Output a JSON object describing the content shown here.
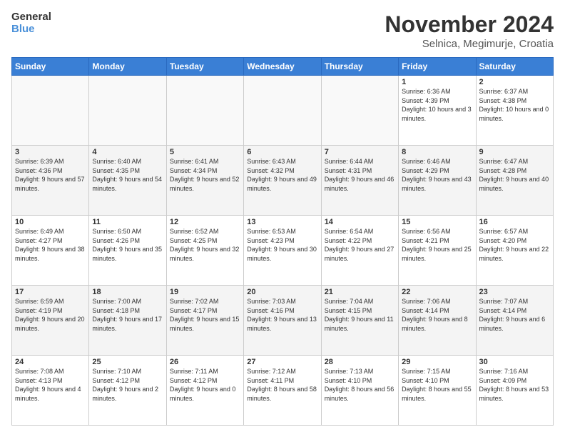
{
  "header": {
    "logo_general": "General",
    "logo_blue": "Blue",
    "month_title": "November 2024",
    "location": "Selnica, Megimurje, Croatia"
  },
  "days_of_week": [
    "Sunday",
    "Monday",
    "Tuesday",
    "Wednesday",
    "Thursday",
    "Friday",
    "Saturday"
  ],
  "weeks": [
    [
      {
        "day": "",
        "info": ""
      },
      {
        "day": "",
        "info": ""
      },
      {
        "day": "",
        "info": ""
      },
      {
        "day": "",
        "info": ""
      },
      {
        "day": "",
        "info": ""
      },
      {
        "day": "1",
        "info": "Sunrise: 6:36 AM\nSunset: 4:39 PM\nDaylight: 10 hours and 3 minutes."
      },
      {
        "day": "2",
        "info": "Sunrise: 6:37 AM\nSunset: 4:38 PM\nDaylight: 10 hours and 0 minutes."
      }
    ],
    [
      {
        "day": "3",
        "info": "Sunrise: 6:39 AM\nSunset: 4:36 PM\nDaylight: 9 hours and 57 minutes."
      },
      {
        "day": "4",
        "info": "Sunrise: 6:40 AM\nSunset: 4:35 PM\nDaylight: 9 hours and 54 minutes."
      },
      {
        "day": "5",
        "info": "Sunrise: 6:41 AM\nSunset: 4:34 PM\nDaylight: 9 hours and 52 minutes."
      },
      {
        "day": "6",
        "info": "Sunrise: 6:43 AM\nSunset: 4:32 PM\nDaylight: 9 hours and 49 minutes."
      },
      {
        "day": "7",
        "info": "Sunrise: 6:44 AM\nSunset: 4:31 PM\nDaylight: 9 hours and 46 minutes."
      },
      {
        "day": "8",
        "info": "Sunrise: 6:46 AM\nSunset: 4:29 PM\nDaylight: 9 hours and 43 minutes."
      },
      {
        "day": "9",
        "info": "Sunrise: 6:47 AM\nSunset: 4:28 PM\nDaylight: 9 hours and 40 minutes."
      }
    ],
    [
      {
        "day": "10",
        "info": "Sunrise: 6:49 AM\nSunset: 4:27 PM\nDaylight: 9 hours and 38 minutes."
      },
      {
        "day": "11",
        "info": "Sunrise: 6:50 AM\nSunset: 4:26 PM\nDaylight: 9 hours and 35 minutes."
      },
      {
        "day": "12",
        "info": "Sunrise: 6:52 AM\nSunset: 4:25 PM\nDaylight: 9 hours and 32 minutes."
      },
      {
        "day": "13",
        "info": "Sunrise: 6:53 AM\nSunset: 4:23 PM\nDaylight: 9 hours and 30 minutes."
      },
      {
        "day": "14",
        "info": "Sunrise: 6:54 AM\nSunset: 4:22 PM\nDaylight: 9 hours and 27 minutes."
      },
      {
        "day": "15",
        "info": "Sunrise: 6:56 AM\nSunset: 4:21 PM\nDaylight: 9 hours and 25 minutes."
      },
      {
        "day": "16",
        "info": "Sunrise: 6:57 AM\nSunset: 4:20 PM\nDaylight: 9 hours and 22 minutes."
      }
    ],
    [
      {
        "day": "17",
        "info": "Sunrise: 6:59 AM\nSunset: 4:19 PM\nDaylight: 9 hours and 20 minutes."
      },
      {
        "day": "18",
        "info": "Sunrise: 7:00 AM\nSunset: 4:18 PM\nDaylight: 9 hours and 17 minutes."
      },
      {
        "day": "19",
        "info": "Sunrise: 7:02 AM\nSunset: 4:17 PM\nDaylight: 9 hours and 15 minutes."
      },
      {
        "day": "20",
        "info": "Sunrise: 7:03 AM\nSunset: 4:16 PM\nDaylight: 9 hours and 13 minutes."
      },
      {
        "day": "21",
        "info": "Sunrise: 7:04 AM\nSunset: 4:15 PM\nDaylight: 9 hours and 11 minutes."
      },
      {
        "day": "22",
        "info": "Sunrise: 7:06 AM\nSunset: 4:14 PM\nDaylight: 9 hours and 8 minutes."
      },
      {
        "day": "23",
        "info": "Sunrise: 7:07 AM\nSunset: 4:14 PM\nDaylight: 9 hours and 6 minutes."
      }
    ],
    [
      {
        "day": "24",
        "info": "Sunrise: 7:08 AM\nSunset: 4:13 PM\nDaylight: 9 hours and 4 minutes."
      },
      {
        "day": "25",
        "info": "Sunrise: 7:10 AM\nSunset: 4:12 PM\nDaylight: 9 hours and 2 minutes."
      },
      {
        "day": "26",
        "info": "Sunrise: 7:11 AM\nSunset: 4:12 PM\nDaylight: 9 hours and 0 minutes."
      },
      {
        "day": "27",
        "info": "Sunrise: 7:12 AM\nSunset: 4:11 PM\nDaylight: 8 hours and 58 minutes."
      },
      {
        "day": "28",
        "info": "Sunrise: 7:13 AM\nSunset: 4:10 PM\nDaylight: 8 hours and 56 minutes."
      },
      {
        "day": "29",
        "info": "Sunrise: 7:15 AM\nSunset: 4:10 PM\nDaylight: 8 hours and 55 minutes."
      },
      {
        "day": "30",
        "info": "Sunrise: 7:16 AM\nSunset: 4:09 PM\nDaylight: 8 hours and 53 minutes."
      }
    ]
  ]
}
